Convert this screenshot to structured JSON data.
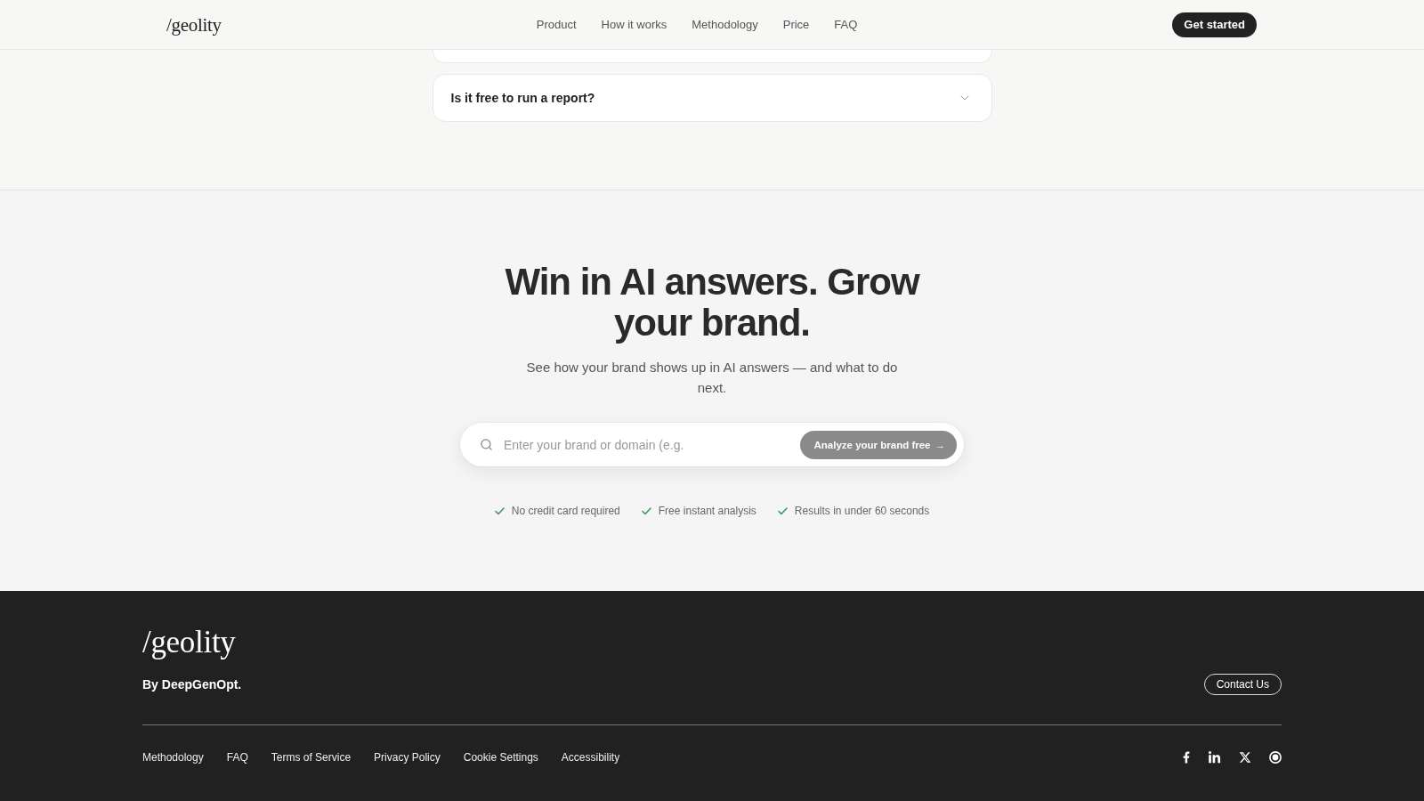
{
  "header": {
    "logo": "/geolity",
    "nav": [
      "Product",
      "How it works",
      "Methodology",
      "Price",
      "FAQ"
    ],
    "cta": "Get started"
  },
  "faq": {
    "items": [
      {
        "question": "Is it free to run a report?",
        "expanded": false
      }
    ]
  },
  "cta_section": {
    "heading": "Win in AI answers. Grow your brand.",
    "subtitle": "See how your brand shows up in AI answers — and what to do next.",
    "search": {
      "placeholder": "Enter your brand or domain (e.g."
    },
    "button": {
      "label": "Analyze your brand free",
      "arrow": "→"
    },
    "perks": [
      "No credit card required",
      "Free instant analysis",
      "Results in under 60 seconds"
    ]
  },
  "footer": {
    "logo": "/geolity",
    "byline": "By DeepGenOpt.",
    "contact_button": "Contact Us",
    "links": [
      "Methodology",
      "FAQ",
      "Terms of Service",
      "Privacy Policy",
      "Cookie Settings",
      "Accessibility"
    ],
    "social": [
      {
        "kind": "facebook"
      },
      {
        "kind": "linkedin"
      },
      {
        "kind": "x"
      },
      {
        "kind": "ring"
      }
    ]
  }
}
